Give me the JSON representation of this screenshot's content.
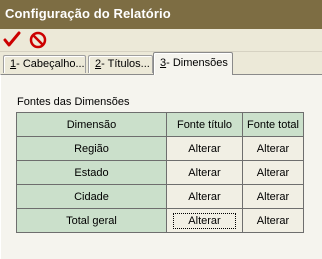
{
  "window": {
    "title": "Configuração do Relatório"
  },
  "toolbar": {
    "confirm_icon": "check-icon",
    "cancel_icon": "prohibited-icon",
    "confirm_color": "#cc0000",
    "cancel_color": "#cc0000"
  },
  "tabs": [
    {
      "key": "1",
      "label": "- Cabeçalho...",
      "active": false
    },
    {
      "key": "2",
      "label": "- Títulos...",
      "active": false
    },
    {
      "key": "3",
      "label": "- Dimensões",
      "active": true
    }
  ],
  "group": {
    "label": "Fontes das Dimensões"
  },
  "table": {
    "headers": [
      "Dimensão",
      "Fonte título",
      "Fonte total"
    ],
    "rows": [
      {
        "dimension": "Região",
        "title_font": "Alterar",
        "total_font": "Alterar"
      },
      {
        "dimension": "Estado",
        "title_font": "Alterar",
        "total_font": "Alterar"
      },
      {
        "dimension": "Cidade",
        "title_font": "Alterar",
        "total_font": "Alterar"
      },
      {
        "dimension": "Total geral",
        "title_font": "Alterar",
        "total_font": "Alterar"
      }
    ]
  },
  "colors": {
    "titlebar": "#7d6d43",
    "header_cell": "#cbe0cb",
    "panel": "#f5f4ee",
    "window_bg": "#ece9d8"
  }
}
